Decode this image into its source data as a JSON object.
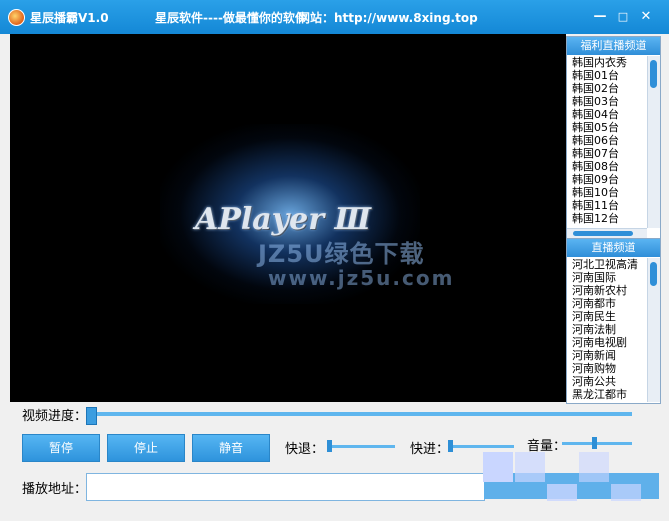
{
  "window": {
    "title": "星辰播霸V1.0",
    "slogan": "星辰软件----做最懂你的软件",
    "website": "网站：http://www.8xing.top",
    "controls": {
      "minimize": "—",
      "maximize": "□",
      "close": "✕"
    }
  },
  "video": {
    "logo_text": "APlayer Ⅲ",
    "watermark": "JZ5U绿色下载",
    "watermark_url": "www.jz5u.com"
  },
  "panels": {
    "fuli": {
      "title": "福利直播频道",
      "items": [
        "韩国内衣秀",
        "韩国01台",
        "韩国02台",
        "韩国03台",
        "韩国04台",
        "韩国05台",
        "韩国06台",
        "韩国07台",
        "韩国08台",
        "韩国09台",
        "韩国10台",
        "韩国11台",
        "韩国12台"
      ]
    },
    "live": {
      "title": "直播频道",
      "items": [
        "河北卫视高清",
        "河南国际",
        "河南新农村",
        "河南都市",
        "河南民生",
        "河南法制",
        "河南电视剧",
        "河南新闻",
        "河南购物",
        "河南公共",
        "黑龙江都市"
      ]
    }
  },
  "controls": {
    "progress_label": "视频进度：",
    "pause": "暂停",
    "stop": "停止",
    "mute": "静音",
    "rewind_label": "快退：",
    "forward_label": "快进：",
    "volume_label": "音量：",
    "address_label": "播放地址：",
    "address_value": ""
  },
  "colors": {
    "accent": "#2e93dc",
    "titlebar": "#1a8fdc"
  },
  "icons": [
    "app-icon",
    "minimize-icon",
    "maximize-icon",
    "close-icon"
  ]
}
